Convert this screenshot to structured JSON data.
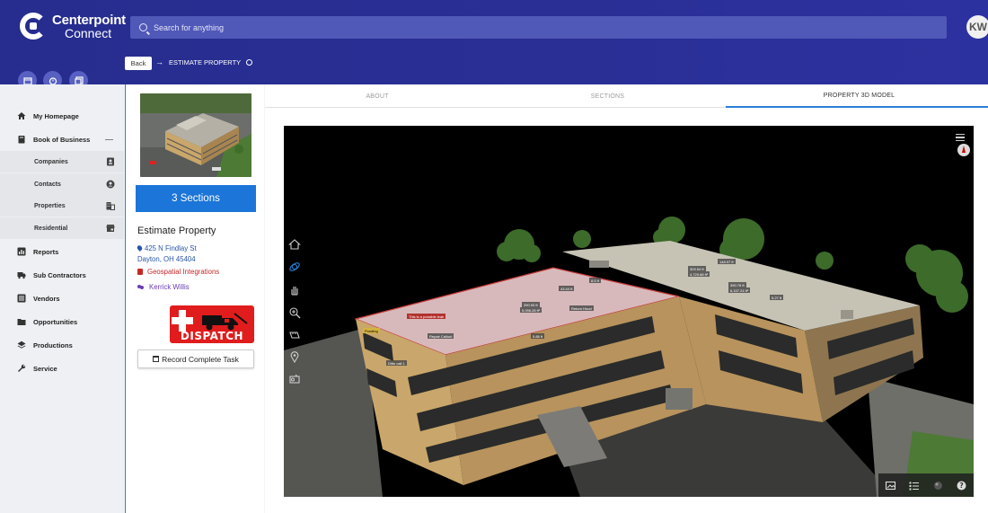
{
  "app": {
    "brand_line1": "Centerpoint",
    "brand_line2": "Connect",
    "search_placeholder": "Search for anything",
    "avatar_initials": "KW"
  },
  "breadcrumb": {
    "back_label": "Back",
    "current": "ESTIMATE PROPERTY"
  },
  "sidebar": {
    "items": [
      {
        "label": "My Homepage",
        "icon": "home-icon"
      },
      {
        "label": "Book of Business",
        "icon": "book-icon"
      },
      {
        "label": "Reports",
        "icon": "chart-icon"
      },
      {
        "label": "Sub Contractors",
        "icon": "truck-icon"
      },
      {
        "label": "Vendors",
        "icon": "list-icon"
      },
      {
        "label": "Opportunities",
        "icon": "folder-icon"
      },
      {
        "label": "Productions",
        "icon": "layers-icon"
      },
      {
        "label": "Service",
        "icon": "wrench-icon"
      }
    ],
    "sub_items": [
      {
        "label": "Companies",
        "icon": "contact-card-icon"
      },
      {
        "label": "Contacts",
        "icon": "account-circle-icon"
      },
      {
        "label": "Properties",
        "icon": "building-icon"
      },
      {
        "label": "Residential",
        "icon": "store-icon"
      }
    ],
    "collapse_symbol": "—"
  },
  "property": {
    "sections_label": "3 Sections",
    "title": "Estimate Property",
    "address_line1": "425 N Findlay St",
    "address_line2": "Dayton, OH 45404",
    "company": "Geospatial Integrations",
    "assignee": "Kerrick Willis",
    "dispatch_label": "DISPATCH",
    "record_task_label": "Record Complete Task"
  },
  "tabs": [
    {
      "label": "ABOUT",
      "active": false
    },
    {
      "label": "SECTIONS",
      "active": false
    },
    {
      "label": "PROPERTY 3D MODEL",
      "active": true
    }
  ],
  "model_labels": {
    "l1": "This is a possible leak",
    "l2": "Repair Callout",
    "l3": "Ponding",
    "l4": "390.93 ft",
    "l5": "5,096.28 ft²",
    "l6": "5.88 ft",
    "l7": "Return Hood",
    "l8": "43.44 ft",
    "l9": "8.6 ft",
    "l10": "Ditto call 1",
    "l11": "148.97 ft",
    "l12": "303.54 ft",
    "l13": "4,729.88 ft²",
    "l14": "390.76 ft",
    "l15": "6,157.24 ft²",
    "l16": "5.27 ft"
  },
  "colors": {
    "header": "#2a2f96",
    "primary_button": "#1c75d8",
    "dispatch_red": "#e11c1c",
    "active_tab_underline": "#2a7fd6"
  }
}
